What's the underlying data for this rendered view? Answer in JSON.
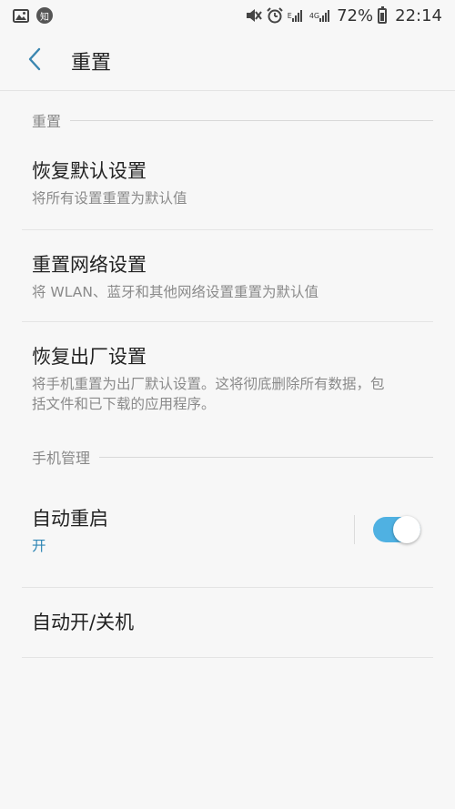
{
  "status_bar": {
    "left_icons": [
      "gallery-icon",
      "zhihu-icon"
    ],
    "zhihu_glyph": "知",
    "network_labels": [
      "E",
      "4G"
    ],
    "battery_percent": "72%",
    "time": "22:14"
  },
  "app_bar": {
    "title": "重置"
  },
  "sections": {
    "reset": {
      "header": "重置",
      "items": [
        {
          "title": "恢复默认设置",
          "subtitle": "将所有设置重置为默认值"
        },
        {
          "title": "重置网络设置",
          "subtitle": "将 WLAN、蓝牙和其他网络设置重置为默认值"
        },
        {
          "title": "恢复出厂设置",
          "subtitle_line1": "将手机重置为出厂默认设置。这将彻底删除所有数据，包",
          "subtitle_line2": "括文件和已下载的应用程序。"
        }
      ]
    },
    "management": {
      "header": "手机管理",
      "auto_restart": {
        "title": "自动重启",
        "status": "开",
        "toggle_on": true
      },
      "auto_power": {
        "title": "自动开/关机"
      }
    }
  },
  "colors": {
    "accent": "#2f86b5",
    "toggle_on": "#4fb1e2",
    "background": "#f7f7f7"
  }
}
